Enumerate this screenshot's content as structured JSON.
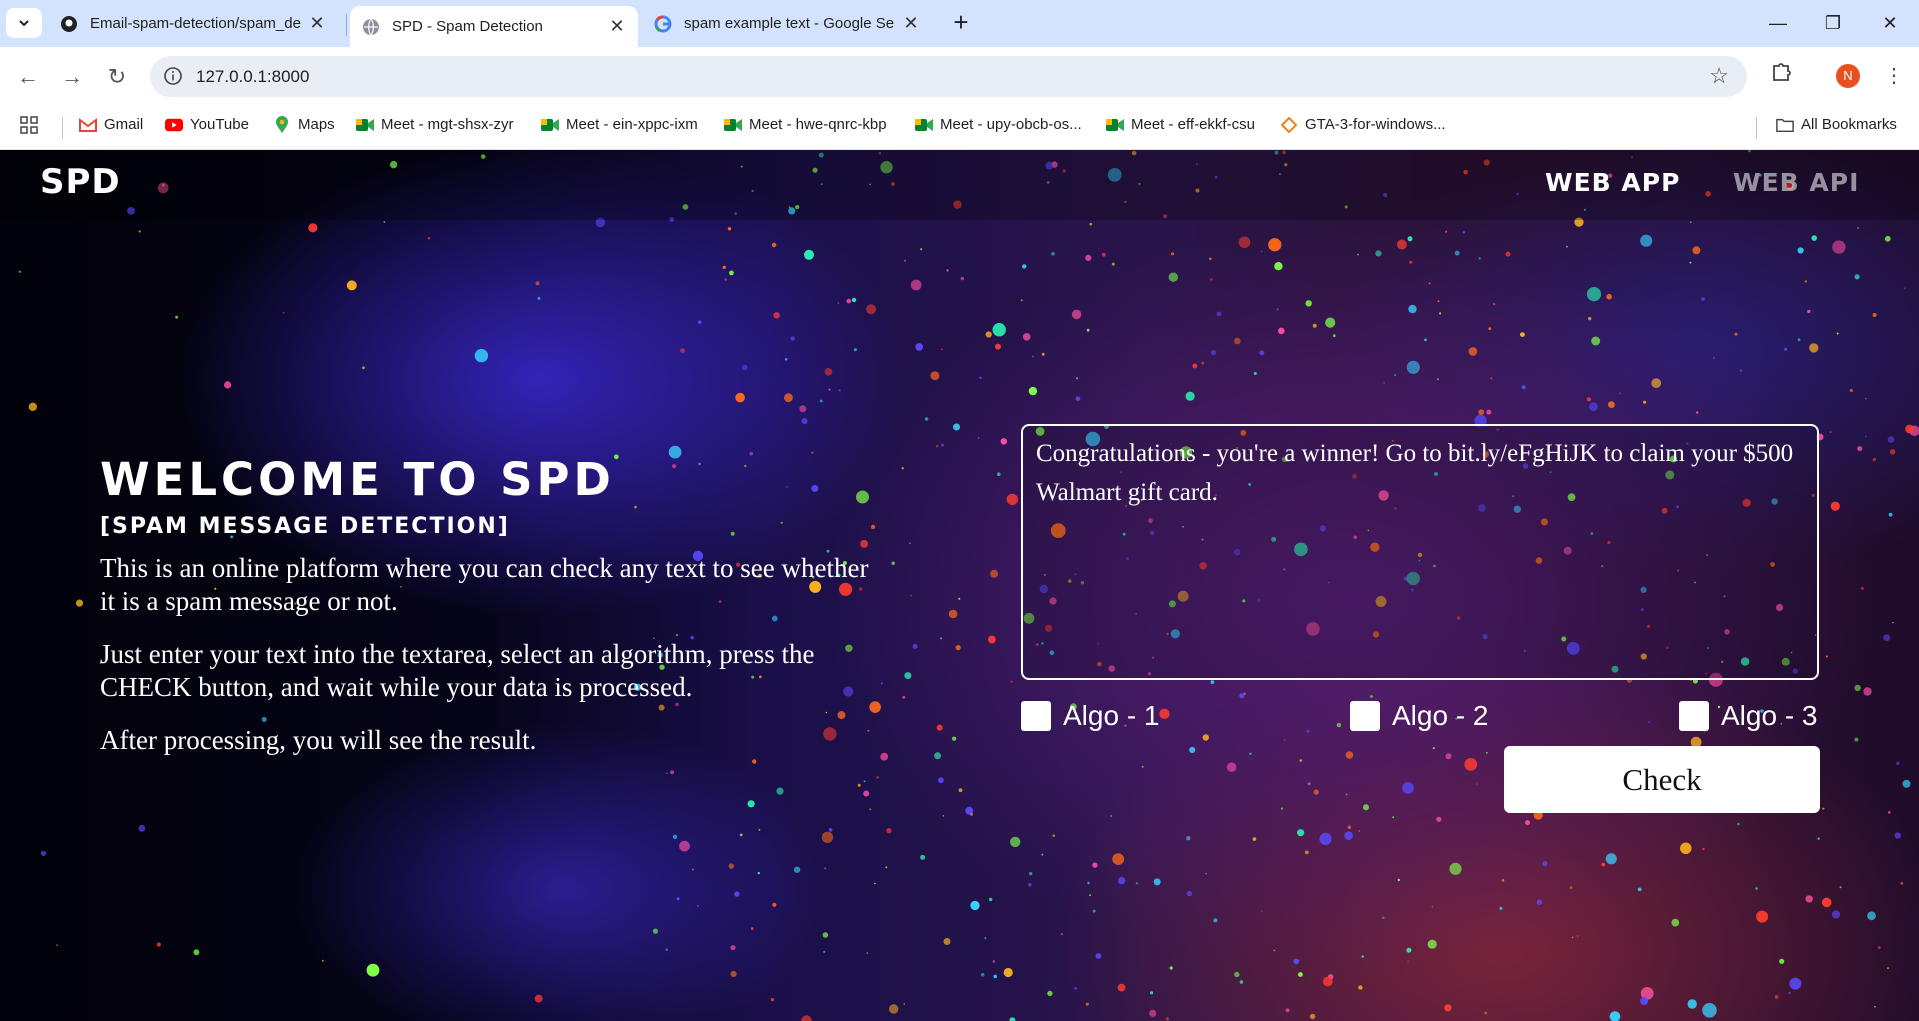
{
  "browser": {
    "tabs": [
      {
        "title": "Email-spam-detection/spam_de",
        "active": false,
        "icon": "github-icon"
      },
      {
        "title": "SPD - Spam Detection",
        "active": true,
        "icon": "globe-icon"
      },
      {
        "title": "spam example text - Google Se",
        "active": false,
        "icon": "google-icon"
      }
    ],
    "url": "127.0.0.1:8000",
    "profile_initial": "N",
    "bookmarks": [
      {
        "label": "Gmail",
        "icon": "gmail-icon"
      },
      {
        "label": "YouTube",
        "icon": "youtube-icon"
      },
      {
        "label": "Maps",
        "icon": "maps-icon"
      },
      {
        "label": "Meet - mgt-shsx-zyr",
        "icon": "meet-icon"
      },
      {
        "label": "Meet - ein-xppc-ixm",
        "icon": "meet-icon"
      },
      {
        "label": "Meet - hwe-qnrc-kbp",
        "icon": "meet-icon"
      },
      {
        "label": "Meet - upy-obcb-os...",
        "icon": "meet-icon"
      },
      {
        "label": "Meet - eff-ekkf-csu",
        "icon": "meet-icon"
      },
      {
        "label": "GTA-3-for-windows...",
        "icon": "diamond-icon"
      }
    ],
    "all_bookmarks": "All Bookmarks"
  },
  "site": {
    "logo": "SPD",
    "nav": {
      "web_app": "WEB APP",
      "web_api": "WEB API"
    },
    "hero": {
      "title": "WELCOME TO SPD",
      "subtitle": "[SPAM MESSAGE DETECTION]",
      "paragraphs": [
        "This is an online platform where you can check any text to see whether it is a spam message or not.",
        "Just enter your text into the textarea, select an algorithm, press the CHECK button, and wait while your data is processed.",
        "After processing, you will see the result."
      ]
    },
    "message_text": "Congratulations - you're a winner! Go to bit.ly/eFgHiJK to claim your $500 Walmart gift card.",
    "algorithms": [
      {
        "label": "Algo - 1",
        "checked": false
      },
      {
        "label": "Algo - 2",
        "checked": false
      },
      {
        "label": "Algo - 3",
        "checked": false
      }
    ],
    "check_button": "Check"
  },
  "colors": {
    "tabstrip_bg": "#d3e3fd",
    "omnibox_bg": "#e9eef6",
    "avatar": "#e8501f",
    "text_light": "#ffffff"
  }
}
